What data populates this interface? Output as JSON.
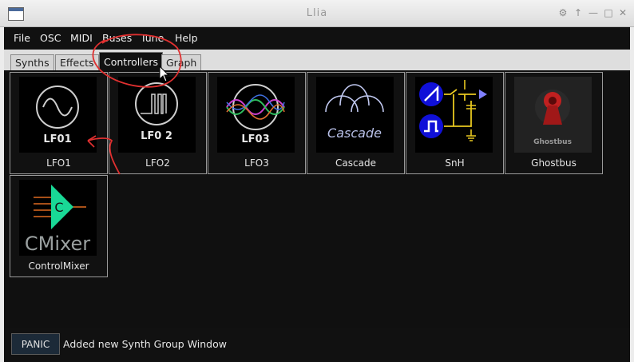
{
  "window": {
    "title": "Llia",
    "controls": [
      "⚙",
      "↑",
      "—",
      "□",
      "✕"
    ]
  },
  "menu": [
    "File",
    "OSC",
    "MIDI",
    "Buses",
    "Tune",
    "Help"
  ],
  "tabs": [
    "Synths",
    "Effects",
    "Controllers",
    "Graph"
  ],
  "active_tab": "Controllers",
  "tiles": [
    {
      "label": "LFO1",
      "thumb_text": "LF01",
      "icon": "sine-wave-icon"
    },
    {
      "label": "LFO2",
      "thumb_text": "LF0 2",
      "icon": "pulse-wave-icon"
    },
    {
      "label": "LFO3",
      "thumb_text": "LF03",
      "icon": "braid-icon"
    },
    {
      "label": "Cascade",
      "thumb_text": "Cascade",
      "icon": "arches-icon"
    },
    {
      "label": "SnH",
      "thumb_text": "",
      "icon": "sample-hold-icon"
    },
    {
      "label": "Ghostbus",
      "thumb_text": "Ghostbus",
      "icon": "keyhole-icon"
    },
    {
      "label": "ControlMixer",
      "thumb_text": "CMixer",
      "icon": "mixer-amp-icon",
      "icon_letter": "C"
    }
  ],
  "status": {
    "panic_label": "PANIC",
    "message": "Added new Synth Group Window"
  },
  "colors": {
    "background": "#101010",
    "annotation": "#e03030",
    "snh_circle": "#1010d8",
    "snh_wire": "#e8c820",
    "cmixer_triangle": "#19d896",
    "cmixer_lines": "#e06a20"
  }
}
